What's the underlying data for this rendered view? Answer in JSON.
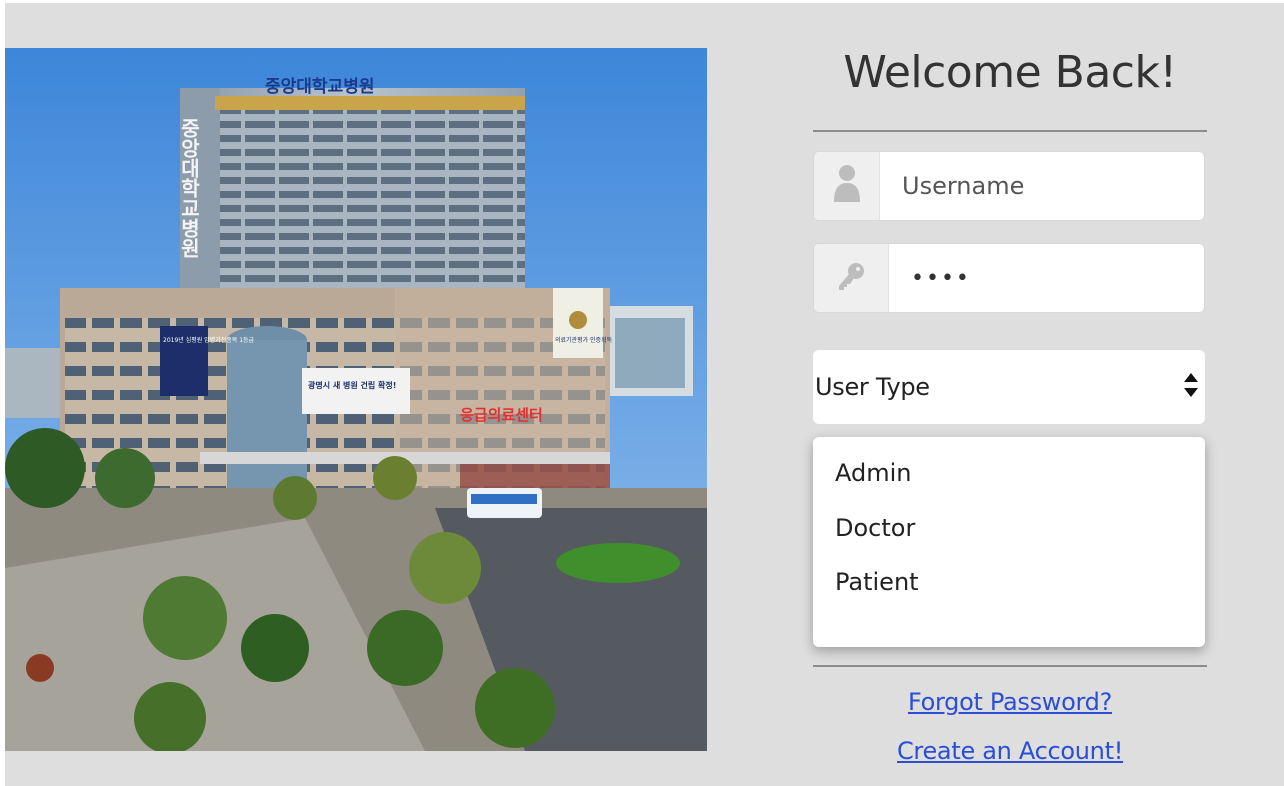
{
  "login": {
    "title": "Welcome Back!",
    "username_placeholder": "Username",
    "password_value": "••••",
    "user_type_label": "User Type",
    "user_type_options": [
      "Admin",
      "Doctor",
      "Patient"
    ],
    "forgot_password_label": "Forgot Password?",
    "create_account_label": "Create an Account!"
  },
  "photo": {
    "sign_main": "중앙대학교병원",
    "sign_vertical": "중앙대학교병원",
    "sign_emergency": "응급의료센터",
    "banner_left": "2019년 심평원 암병가전종목 1등급",
    "banner_center": "광명시 새 병원 건립 확정!",
    "banner_right": "의료기관평가 인증획득"
  },
  "icons": {
    "username": "user-icon",
    "password": "key-icon",
    "select": "sort-arrows-icon"
  },
  "colors": {
    "background": "#dedede",
    "link": "#2a4fd6",
    "addon": "#efefef"
  }
}
